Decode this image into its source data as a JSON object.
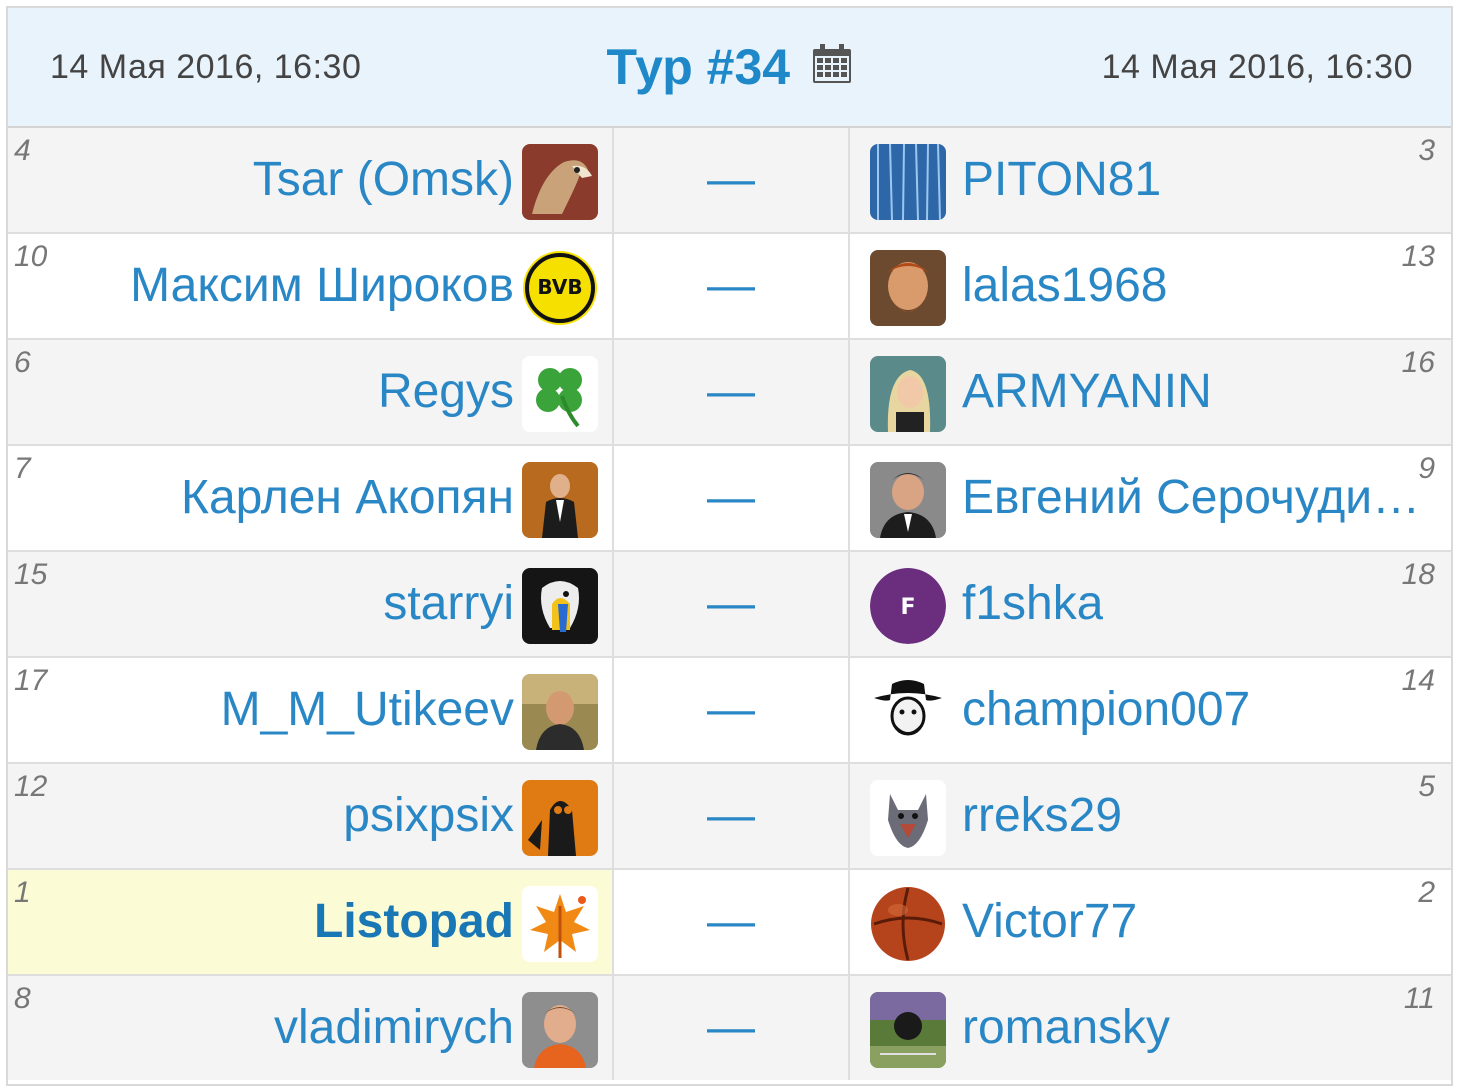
{
  "round": {
    "title": "Тур #34",
    "date_left": "14 Мая 2016, 16:30",
    "date_right": "14 Мая 2016, 16:30",
    "calendar_icon": "calendar-icon"
  },
  "matches": [
    {
      "home": {
        "pos": "4",
        "name": "Tsar (Omsk)",
        "avatar": "eagle-avatar"
      },
      "score": "—",
      "away": {
        "pos": "3",
        "name": "PITON81",
        "avatar": "blue-rain-avatar"
      }
    },
    {
      "home": {
        "pos": "10",
        "name": "Максим Широков",
        "avatar": "bvb-logo-avatar"
      },
      "score": "—",
      "away": {
        "pos": "13",
        "name": "lalas1968",
        "avatar": "bearded-man-avatar"
      }
    },
    {
      "home": {
        "pos": "6",
        "name": "Regys",
        "avatar": "clover-avatar"
      },
      "score": "—",
      "away": {
        "pos": "16",
        "name": "ARMYANIN",
        "avatar": "blonde-woman-avatar"
      }
    },
    {
      "home": {
        "pos": "7",
        "name": "Карлен Акопян",
        "avatar": "suit-man-avatar"
      },
      "score": "—",
      "away": {
        "pos": "9",
        "name": "Евгений Серочудинов",
        "avatar": "man-portrait-avatar"
      }
    },
    {
      "home": {
        "pos": "15",
        "name": "starryi",
        "avatar": "parrot-avatar"
      },
      "score": "—",
      "away": {
        "pos": "18",
        "name": "f1shka",
        "avatar": "letter-f-avatar",
        "avatar_letter": "F"
      }
    },
    {
      "home": {
        "pos": "17",
        "name": "M_M_Utikeev",
        "avatar": "man-outdoor-avatar"
      },
      "score": "—",
      "away": {
        "pos": "14",
        "name": "champion007",
        "avatar": "cowboy-avatar"
      }
    },
    {
      "home": {
        "pos": "12",
        "name": "psixpsix",
        "avatar": "dark-figure-avatar"
      },
      "score": "—",
      "away": {
        "pos": "5",
        "name": "rreks29",
        "avatar": "wolf-avatar"
      }
    },
    {
      "home": {
        "pos": "1",
        "name": "Listopad",
        "avatar": "autumn-leaf-avatar",
        "highlight": true
      },
      "score": "—",
      "away": {
        "pos": "2",
        "name": "Victor77",
        "avatar": "ball-avatar"
      }
    },
    {
      "home": {
        "pos": "8",
        "name": "vladimirych",
        "avatar": "young-man-avatar"
      },
      "score": "—",
      "away": {
        "pos": "11",
        "name": "romansky",
        "avatar": "stadium-avatar"
      }
    }
  ],
  "colors": {
    "link": "#2a87c6",
    "header_bg": "#e9f3fb",
    "highlight_bg": "#fbfcd6"
  }
}
